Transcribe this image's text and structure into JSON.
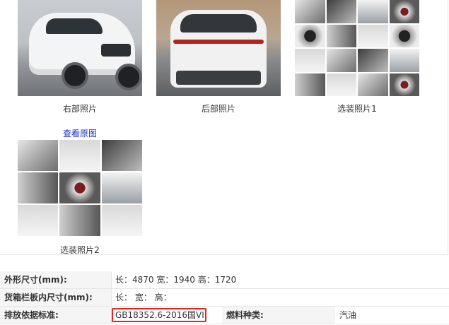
{
  "gallery": {
    "photos": [
      {
        "caption": "右部照片",
        "icon": "car-right-side-photo"
      },
      {
        "caption": "后部照片",
        "icon": "car-rear-photo"
      },
      {
        "caption": "选装照片1",
        "icon": "option-collage-photo"
      },
      {
        "caption": "选装照片2",
        "icon": "option-collage-photo"
      }
    ],
    "view_original_label": "查看原图"
  },
  "specs": {
    "dimensions": {
      "label": "外形尺寸(mm):",
      "value": "长：4870 宽：1940 高：1720"
    },
    "cargo_box": {
      "label": "货箱栏板内尺寸(mm):",
      "value": "长： 宽： 高："
    },
    "emission": {
      "label": "排放依据标准:",
      "value": "GB18352.6-2016国VI"
    },
    "fuel": {
      "label": "燃料种类:",
      "value": "汽油"
    }
  },
  "colors": {
    "highlight": "#e3231c",
    "link": "#1a2fd0",
    "label_bg": "#f5f5f5"
  }
}
